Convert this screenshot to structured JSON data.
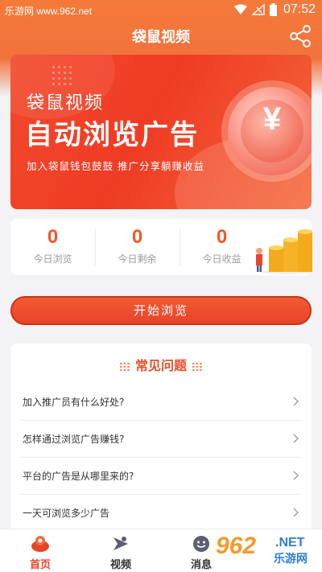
{
  "status_bar": {
    "watermark": "乐游网 www.962.net",
    "time": "07:52"
  },
  "header": {
    "title": "袋鼠视频",
    "share_icon": "share-icon"
  },
  "banner": {
    "title": "袋鼠视频",
    "headline": "自动浏览广告",
    "subtitle": "加入袋鼠钱包鼓鼓 推广分享躺赚收益",
    "coin_symbol": "¥"
  },
  "stats": [
    {
      "value": "0",
      "label": "今日浏览"
    },
    {
      "value": "0",
      "label": "今日剩余"
    },
    {
      "value": "0",
      "label": "今日收益"
    }
  ],
  "start_button": {
    "label": "开始浏览"
  },
  "faq": {
    "title": "常见问题",
    "items": [
      {
        "question": "加入推广员有什么好处?"
      },
      {
        "question": "怎样通过浏览广告赚钱?"
      },
      {
        "question": "平台的广告是从哪里来的?"
      },
      {
        "question": "一天可浏览多少广告"
      }
    ]
  },
  "tabbar": {
    "items": [
      {
        "label": "首页",
        "icon": "home-icon",
        "active": true
      },
      {
        "label": "视频",
        "icon": "video-icon",
        "active": false
      },
      {
        "label": "消息",
        "icon": "message-icon",
        "active": false
      }
    ]
  },
  "watermark_bottom": {
    "brand_number": "962",
    "domain": ".NET",
    "name": "乐游网"
  },
  "colors": {
    "accent": "#e8442a",
    "header": "#f47a3a",
    "value": "#f2572a"
  }
}
